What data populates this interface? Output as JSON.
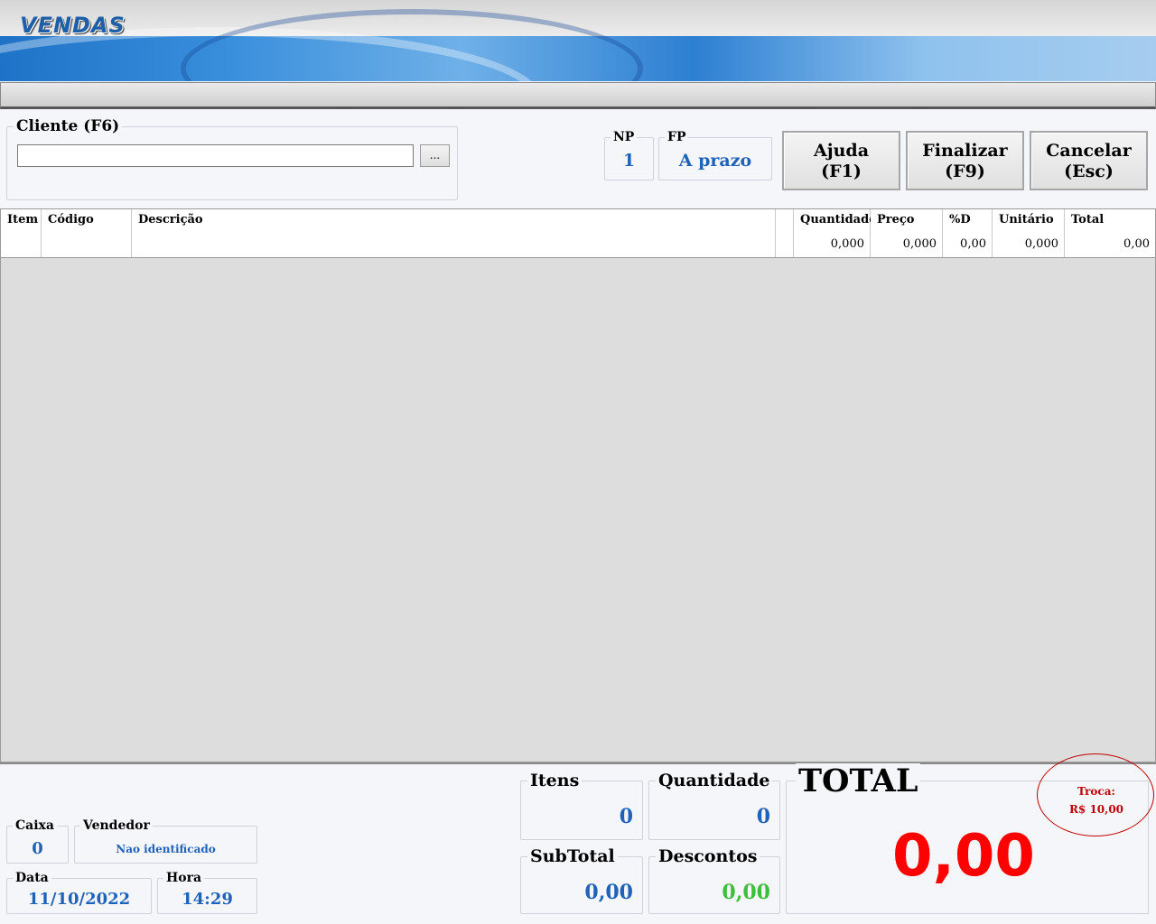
{
  "header": {
    "title": "VENDAS"
  },
  "cliente": {
    "label": "Cliente (F6)",
    "value": "",
    "lookup_label": "..."
  },
  "np": {
    "label": "NP",
    "value": "1"
  },
  "fp": {
    "label": "FP",
    "value": "A prazo"
  },
  "buttons": {
    "ajuda": {
      "line1": "Ajuda",
      "line2": "(F1)"
    },
    "finalizar": {
      "line1": "Finalizar",
      "line2": "(F9)"
    },
    "cancelar": {
      "line1": "Cancelar",
      "line2": "(Esc)"
    }
  },
  "grid": {
    "columns": [
      "Item",
      "Código",
      "Descrição",
      "Quantidade",
      "Preço",
      "%D",
      "Unitário",
      "Total"
    ],
    "entry_row": {
      "quantidade": "0,000",
      "preco": "0,000",
      "desconto": "0,00",
      "unitario": "0,000",
      "total": "0,00"
    }
  },
  "caixa": {
    "label": "Caixa",
    "value": "0"
  },
  "vendedor": {
    "label": "Vendedor",
    "value": "Nao identificado"
  },
  "data": {
    "label": "Data",
    "value": "11/10/2022"
  },
  "hora": {
    "label": "Hora",
    "value": "14:29"
  },
  "itens": {
    "label": "Itens",
    "value": "0"
  },
  "quantidade": {
    "label": "Quantidade",
    "value": "0"
  },
  "subtotal": {
    "label": "SubTotal",
    "value": "0,00"
  },
  "descontos": {
    "label": "Descontos",
    "value": "0,00"
  },
  "total": {
    "label": "TOTAL",
    "value": "0,00"
  },
  "troca": {
    "label": "Troca:",
    "value": "R$ 10,00"
  },
  "colors": {
    "accent_blue": "#1f63b8",
    "total_red": "#ff0000",
    "discount_green": "#3cc03c",
    "troca_red": "#c00000"
  }
}
